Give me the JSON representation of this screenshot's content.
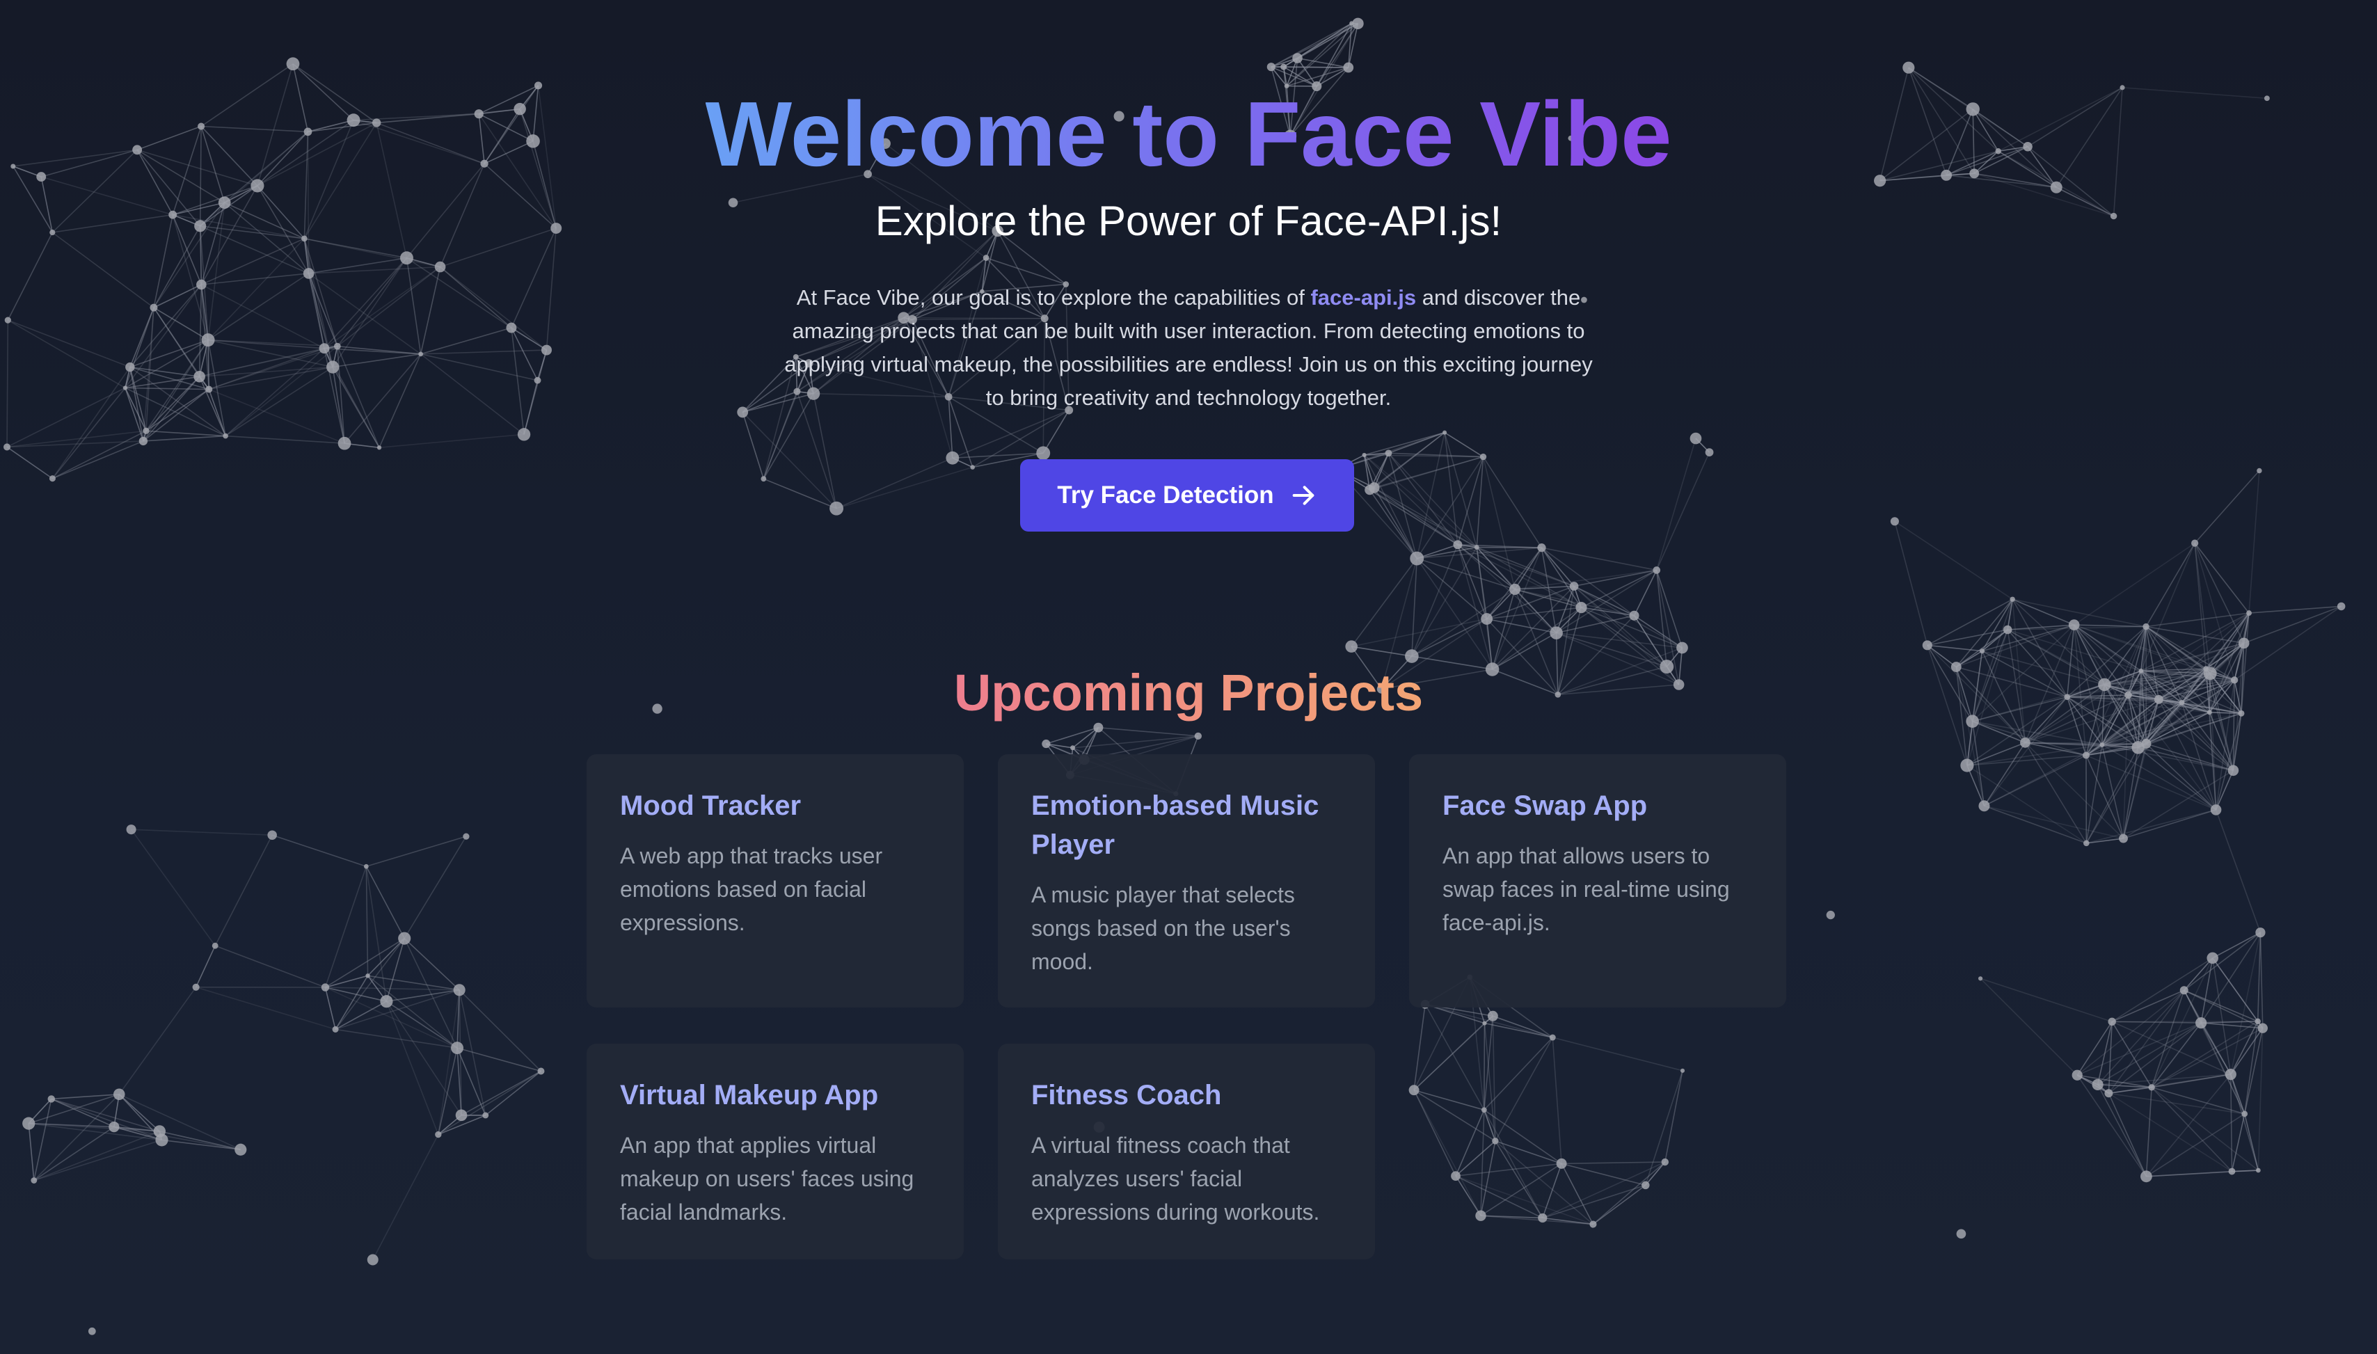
{
  "hero": {
    "title": "Welcome to Face Vibe",
    "subtitle": "Explore the Power of Face-API.js!",
    "intro_before": "At Face Vibe, our goal is to explore the capabilities of ",
    "intro_highlight": "face-api.js",
    "intro_after": " and discover the amazing projects that can be built with user interaction. From detecting emotions to applying virtual makeup, the possibilities are endless! Join us on this exciting journey to bring creativity and technology together.",
    "cta_label": "Try Face Detection",
    "cta_icon": "arrow-right-icon"
  },
  "projects": {
    "section_title": "Upcoming Projects",
    "items": [
      {
        "title": "Mood Tracker",
        "description": "A web app that tracks user emotions based on facial expressions."
      },
      {
        "title": "Emotion-based Music Player",
        "description": "A music player that selects songs based on the user's mood."
      },
      {
        "title": "Face Swap App",
        "description": "An app that allows users to swap faces in real-time using face-api.js."
      },
      {
        "title": "Virtual Makeup App",
        "description": "An app that applies virtual makeup on users' faces using facial landmarks."
      },
      {
        "title": "Fitness Coach",
        "description": "A virtual fitness coach that analyzes users' facial expressions during workouts."
      }
    ]
  },
  "colors": {
    "background": "#161b29",
    "primary_button": "#4f46e5",
    "title_gradient_start": "#6aa0f5",
    "title_gradient_end": "#8b48e6",
    "section_gradient_start": "#ee7e8e",
    "section_gradient_end": "#f3a574",
    "card_title": "#a3adf6",
    "card_text": "#9ca3af",
    "highlight": "#8f8bf2"
  }
}
